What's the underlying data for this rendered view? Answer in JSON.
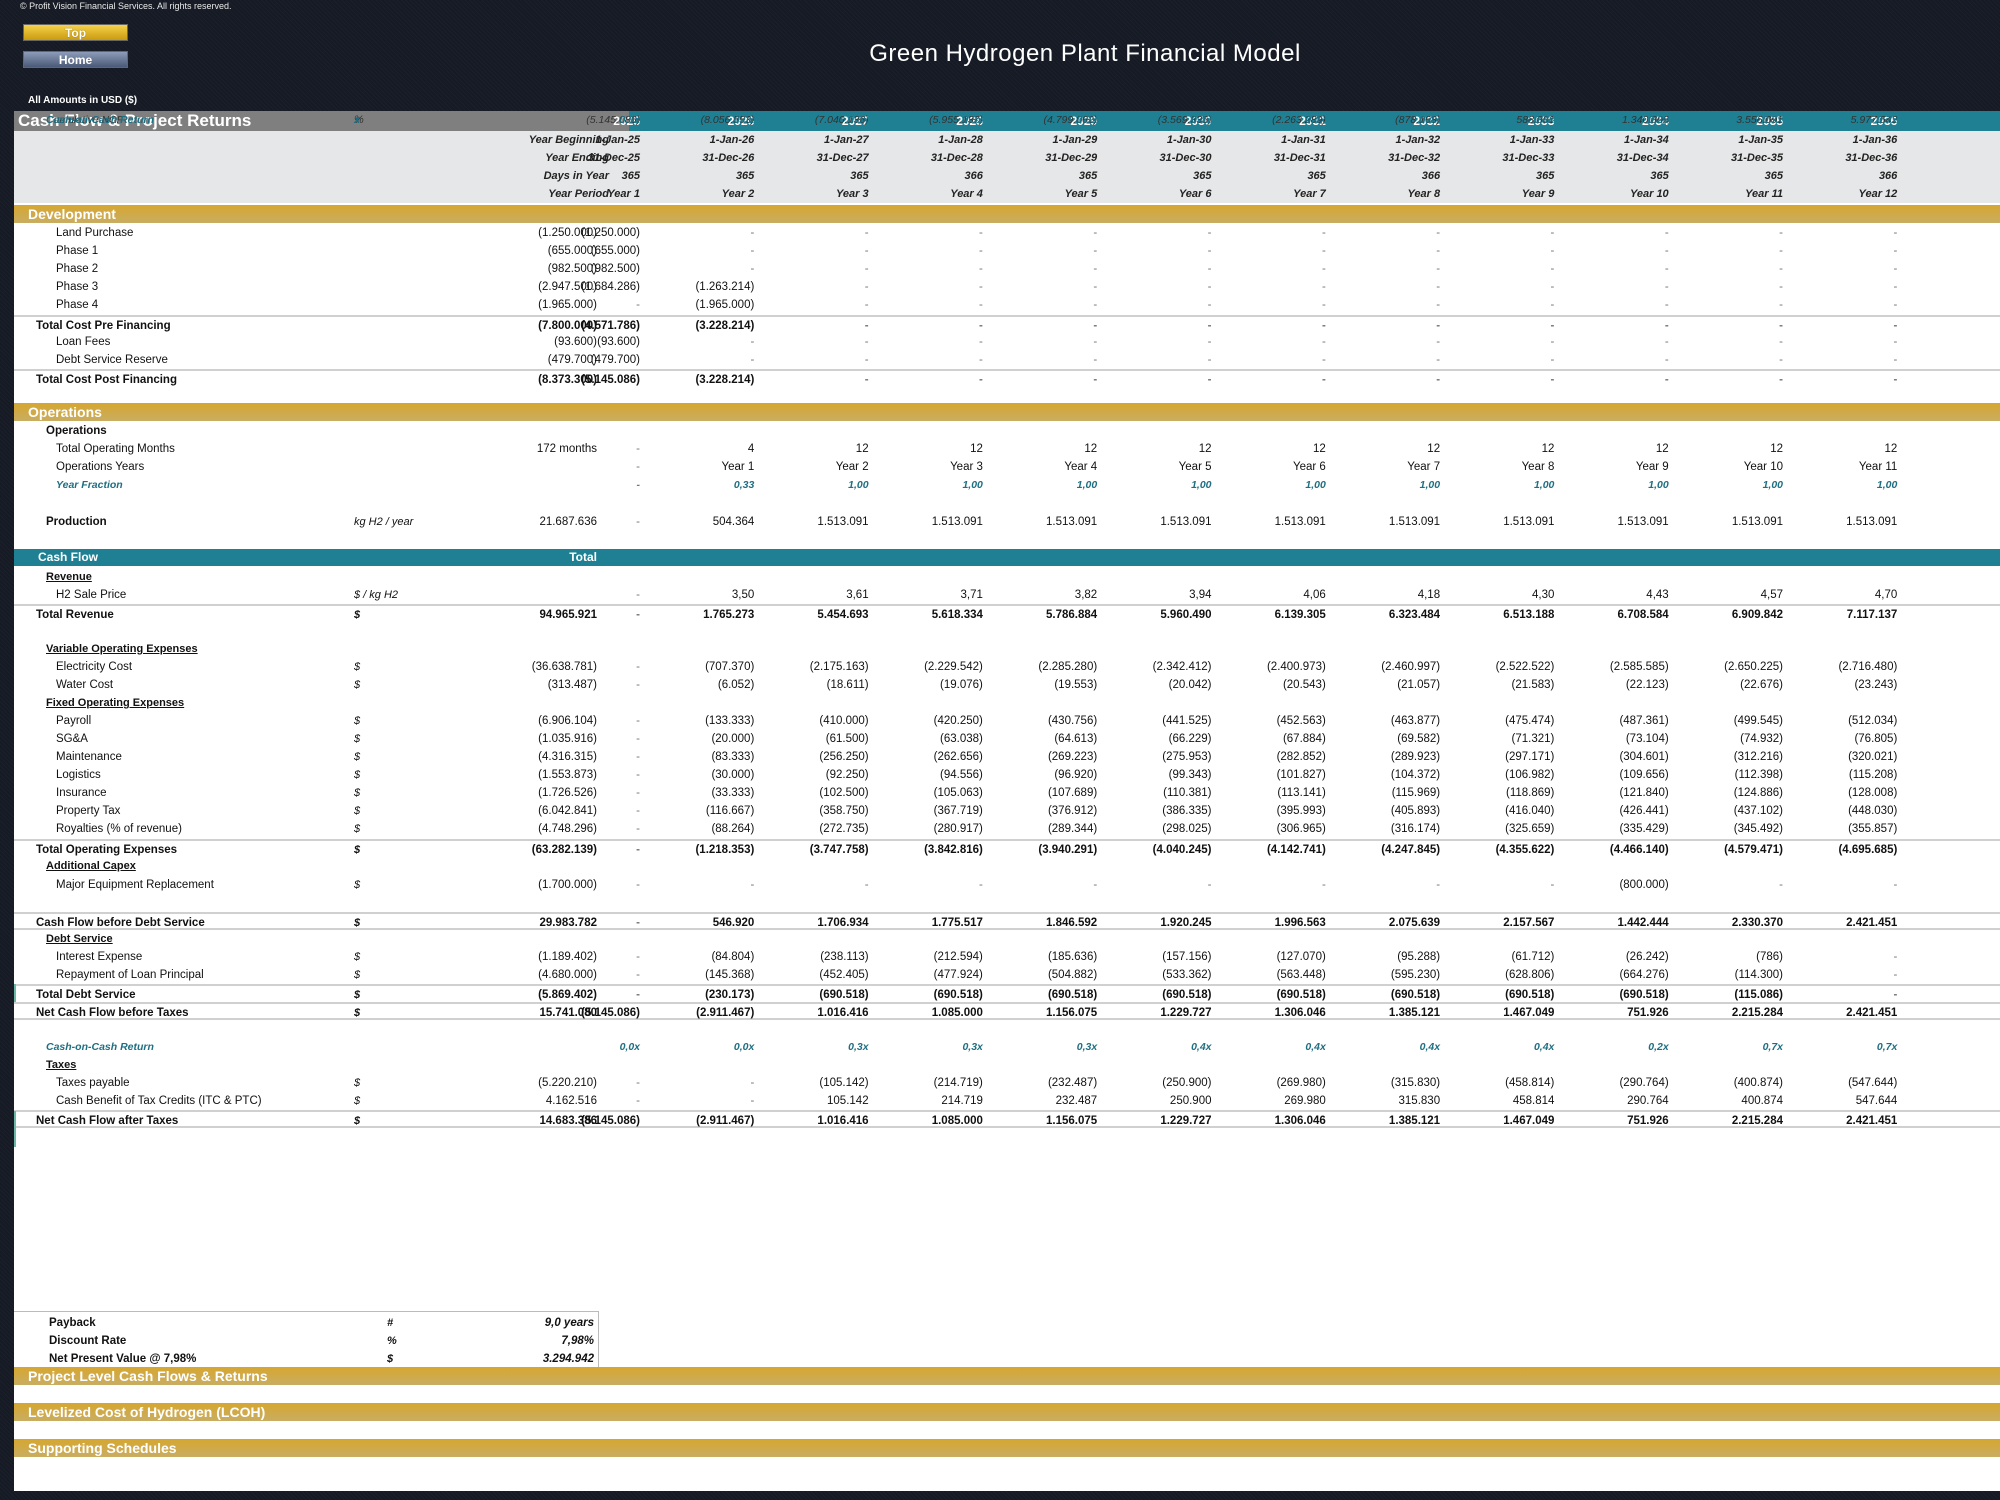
{
  "copyright": "© Profit Vision Financial Services. All rights reserved.",
  "nav": {
    "top_label": "Top",
    "home_label": "Home"
  },
  "title": "Green Hydrogen Plant Financial Model",
  "amounts_note": "All Amounts in  USD ($)",
  "sheet_title": "Cash Flow & Project Returns",
  "years": [
    "2025",
    "2026",
    "2027",
    "2028",
    "2029",
    "2030",
    "2031",
    "2032",
    "2033",
    "2034",
    "2035",
    "2036"
  ],
  "period": [
    {
      "label": "Year Beginning",
      "values": [
        "1-Jan-25",
        "1-Jan-26",
        "1-Jan-27",
        "1-Jan-28",
        "1-Jan-29",
        "1-Jan-30",
        "1-Jan-31",
        "1-Jan-32",
        "1-Jan-33",
        "1-Jan-34",
        "1-Jan-35",
        "1-Jan-36"
      ]
    },
    {
      "label": "Year Ending",
      "values": [
        "31-Dec-25",
        "31-Dec-26",
        "31-Dec-27",
        "31-Dec-28",
        "31-Dec-29",
        "31-Dec-30",
        "31-Dec-31",
        "31-Dec-32",
        "31-Dec-33",
        "31-Dec-34",
        "31-Dec-35",
        "31-Dec-36"
      ]
    },
    {
      "label": "Days in Year",
      "values": [
        "365",
        "365",
        "365",
        "366",
        "365",
        "365",
        "365",
        "366",
        "365",
        "365",
        "365",
        "366"
      ]
    },
    {
      "label": "Year Period",
      "values": [
        "Year 1",
        "Year 2",
        "Year 3",
        "Year 4",
        "Year 5",
        "Year 6",
        "Year 7",
        "Year 8",
        "Year 9",
        "Year 10",
        "Year 11",
        "Year 12"
      ]
    }
  ],
  "sections": {
    "development": "Development",
    "operations": "Operations",
    "cash_flow": "Cash Flow",
    "cash_flow_total": "Total",
    "project_level": "Project Level Cash Flows & Returns",
    "lcoh": "Levelized Cost of Hydrogen (LCOH)",
    "supporting": "Supporting Schedules"
  },
  "development_rows": [
    {
      "label": "Land Purchase",
      "style": "lvl2",
      "total": "(1.250.000)",
      "values": [
        "(1.250.000)",
        "-",
        "-",
        "-",
        "-",
        "-",
        "-",
        "-",
        "-",
        "-",
        "-",
        "-"
      ]
    },
    {
      "label": "Phase 1",
      "style": "lvl2",
      "total": "(655.000)",
      "values": [
        "(655.000)",
        "-",
        "-",
        "-",
        "-",
        "-",
        "-",
        "-",
        "-",
        "-",
        "-",
        "-"
      ]
    },
    {
      "label": "Phase 2",
      "style": "lvl2",
      "total": "(982.500)",
      "values": [
        "(982.500)",
        "-",
        "-",
        "-",
        "-",
        "-",
        "-",
        "-",
        "-",
        "-",
        "-",
        "-"
      ]
    },
    {
      "label": "Phase 3",
      "style": "lvl2",
      "total": "(2.947.500)",
      "values": [
        "(1.684.286)",
        "(1.263.214)",
        "-",
        "-",
        "-",
        "-",
        "-",
        "-",
        "-",
        "-",
        "-",
        "-"
      ]
    },
    {
      "label": "Phase 4",
      "style": "lvl2",
      "total": "(1.965.000)",
      "values": [
        "-",
        "(1.965.000)",
        "-",
        "-",
        "-",
        "-",
        "-",
        "-",
        "-",
        "-",
        "-",
        "-"
      ]
    },
    {
      "label": "Total Cost Pre Financing",
      "style": "bold topline",
      "total": "(7.800.000)",
      "values": [
        "(4.571.786)",
        "(3.228.214)",
        "-",
        "-",
        "-",
        "-",
        "-",
        "-",
        "-",
        "-",
        "-",
        "-"
      ]
    },
    {
      "label": "Loan Fees",
      "style": "lvl2",
      "total": "(93.600)",
      "values": [
        "(93.600)",
        "-",
        "-",
        "-",
        "-",
        "-",
        "-",
        "-",
        "-",
        "-",
        "-",
        "-"
      ]
    },
    {
      "label": "Debt Service Reserve",
      "style": "lvl2",
      "total": "(479.700)",
      "values": [
        "(479.700)",
        "-",
        "-",
        "-",
        "-",
        "-",
        "-",
        "-",
        "-",
        "-",
        "-",
        "-"
      ]
    },
    {
      "label": "Total Cost Post Financing",
      "style": "bold topline",
      "total": "(8.373.300)",
      "values": [
        "(5.145.086)",
        "(3.228.214)",
        "-",
        "-",
        "-",
        "-",
        "-",
        "-",
        "-",
        "-",
        "-",
        "-"
      ]
    }
  ],
  "operations_rows": [
    {
      "label": "Operations",
      "style": "plainhead lvl1",
      "total": "",
      "values": []
    },
    {
      "label": "Total Operating Months",
      "style": "lvl2",
      "total": "172 months",
      "values": [
        "-",
        "4",
        "12",
        "12",
        "12",
        "12",
        "12",
        "12",
        "12",
        "12",
        "12",
        "12"
      ]
    },
    {
      "label": "Operations Years",
      "style": "lvl2",
      "total": "",
      "values": [
        "-",
        "Year 1",
        "Year 2",
        "Year 3",
        "Year 4",
        "Year 5",
        "Year 6",
        "Year 7",
        "Year 8",
        "Year 9",
        "Year 10",
        "Year 11"
      ]
    },
    {
      "label": "Year Fraction",
      "style": "teal lvl2",
      "total": "",
      "values": [
        "-",
        "0,33",
        "1,00",
        "1,00",
        "1,00",
        "1,00",
        "1,00",
        "1,00",
        "1,00",
        "1,00",
        "1,00",
        "1,00"
      ]
    },
    {
      "label": "Production",
      "style": "plainhead lvl1",
      "unit": "kg H2 / year",
      "total": "21.687.636",
      "values": [
        "-",
        "504.364",
        "1.513.091",
        "1.513.091",
        "1.513.091",
        "1.513.091",
        "1.513.091",
        "1.513.091",
        "1.513.091",
        "1.513.091",
        "1.513.091",
        "1.513.091"
      ]
    }
  ],
  "cashflow_rows": [
    {
      "label": "Revenue",
      "style": "heading lvl1",
      "total": "",
      "values": []
    },
    {
      "label": "H2 Sale Price",
      "style": "lvl2",
      "unit": "$ / kg H2",
      "total": "",
      "values": [
        "-",
        "3,50",
        "3,61",
        "3,71",
        "3,82",
        "3,94",
        "4,06",
        "4,18",
        "4,30",
        "4,43",
        "4,57",
        "4,70"
      ]
    },
    {
      "label": "Total Revenue",
      "style": "bold topline lvl0",
      "unit": "$",
      "total": "94.965.921",
      "values": [
        "-",
        "1.765.273",
        "5.454.693",
        "5.618.334",
        "5.786.884",
        "5.960.490",
        "6.139.305",
        "6.323.484",
        "6.513.188",
        "6.708.584",
        "6.909.842",
        "7.117.137"
      ]
    },
    {
      "label": "Variable Operating Expenses",
      "style": "heading lvl1",
      "total": "",
      "values": []
    },
    {
      "label": "Electricity Cost",
      "style": "lvl2",
      "unit": "$",
      "total": "(36.638.781)",
      "values": [
        "-",
        "(707.370)",
        "(2.175.163)",
        "(2.229.542)",
        "(2.285.280)",
        "(2.342.412)",
        "(2.400.973)",
        "(2.460.997)",
        "(2.522.522)",
        "(2.585.585)",
        "(2.650.225)",
        "(2.716.480)"
      ]
    },
    {
      "label": "Water Cost",
      "style": "lvl2",
      "unit": "$",
      "total": "(313.487)",
      "values": [
        "-",
        "(6.052)",
        "(18.611)",
        "(19.076)",
        "(19.553)",
        "(20.042)",
        "(20.543)",
        "(21.057)",
        "(21.583)",
        "(22.123)",
        "(22.676)",
        "(23.243)"
      ]
    },
    {
      "label": "Fixed Operating Expenses",
      "style": "heading lvl1",
      "total": "",
      "values": []
    },
    {
      "label": "Payroll",
      "style": "lvl2",
      "unit": "$",
      "total": "(6.906.104)",
      "values": [
        "-",
        "(133.333)",
        "(410.000)",
        "(420.250)",
        "(430.756)",
        "(441.525)",
        "(452.563)",
        "(463.877)",
        "(475.474)",
        "(487.361)",
        "(499.545)",
        "(512.034)"
      ]
    },
    {
      "label": "SG&A",
      "style": "lvl2",
      "unit": "$",
      "total": "(1.035.916)",
      "values": [
        "-",
        "(20.000)",
        "(61.500)",
        "(63.038)",
        "(64.613)",
        "(66.229)",
        "(67.884)",
        "(69.582)",
        "(71.321)",
        "(73.104)",
        "(74.932)",
        "(76.805)"
      ]
    },
    {
      "label": "Maintenance",
      "style": "lvl2",
      "unit": "$",
      "total": "(4.316.315)",
      "values": [
        "-",
        "(83.333)",
        "(256.250)",
        "(262.656)",
        "(269.223)",
        "(275.953)",
        "(282.852)",
        "(289.923)",
        "(297.171)",
        "(304.601)",
        "(312.216)",
        "(320.021)"
      ]
    },
    {
      "label": "Logistics",
      "style": "lvl2",
      "unit": "$",
      "total": "(1.553.873)",
      "values": [
        "-",
        "(30.000)",
        "(92.250)",
        "(94.556)",
        "(96.920)",
        "(99.343)",
        "(101.827)",
        "(104.372)",
        "(106.982)",
        "(109.656)",
        "(112.398)",
        "(115.208)"
      ]
    },
    {
      "label": "Insurance",
      "style": "lvl2",
      "unit": "$",
      "total": "(1.726.526)",
      "values": [
        "-",
        "(33.333)",
        "(102.500)",
        "(105.063)",
        "(107.689)",
        "(110.381)",
        "(113.141)",
        "(115.969)",
        "(118.869)",
        "(121.840)",
        "(124.886)",
        "(128.008)"
      ]
    },
    {
      "label": "Property Tax",
      "style": "lvl2",
      "unit": "$",
      "total": "(6.042.841)",
      "values": [
        "-",
        "(116.667)",
        "(358.750)",
        "(367.719)",
        "(376.912)",
        "(386.335)",
        "(395.993)",
        "(405.893)",
        "(416.040)",
        "(426.441)",
        "(437.102)",
        "(448.030)"
      ]
    },
    {
      "label": "Royalties (% of revenue)",
      "style": "lvl2",
      "unit": "$",
      "total": "(4.748.296)",
      "values": [
        "-",
        "(88.264)",
        "(272.735)",
        "(280.917)",
        "(289.344)",
        "(298.025)",
        "(306.965)",
        "(316.174)",
        "(325.659)",
        "(335.429)",
        "(345.492)",
        "(355.857)"
      ]
    },
    {
      "label": "Total Operating Expenses",
      "style": "bold topline lvl0",
      "unit": "$",
      "total": "(63.282.139)",
      "values": [
        "-",
        "(1.218.353)",
        "(3.747.758)",
        "(3.842.816)",
        "(3.940.291)",
        "(4.040.245)",
        "(4.142.741)",
        "(4.247.845)",
        "(4.355.622)",
        "(4.466.140)",
        "(4.579.471)",
        "(4.695.685)"
      ]
    },
    {
      "label": "Additional Capex",
      "style": "heading lvl1",
      "total": "",
      "values": []
    },
    {
      "label": "Major Equipment Replacement",
      "style": "lvl2",
      "unit": "$",
      "total": "(1.700.000)",
      "values": [
        "-",
        "-",
        "-",
        "-",
        "-",
        "-",
        "-",
        "-",
        "-",
        "(800.000)",
        "-",
        "-"
      ]
    },
    {
      "label": "Cash Flow before Debt Service",
      "style": "bold boldline lvl0",
      "unit": "$",
      "total": "29.983.782",
      "values": [
        "-",
        "546.920",
        "1.706.934",
        "1.775.517",
        "1.846.592",
        "1.920.245",
        "1.996.563",
        "2.075.639",
        "2.157.567",
        "1.442.444",
        "2.330.370",
        "2.421.451"
      ]
    },
    {
      "label": "Debt Service",
      "style": "heading lvl1",
      "total": "",
      "values": []
    },
    {
      "label": "Interest Expense",
      "style": "lvl2",
      "unit": "$",
      "total": "(1.189.402)",
      "values": [
        "-",
        "(84.804)",
        "(238.113)",
        "(212.594)",
        "(185.636)",
        "(157.156)",
        "(127.070)",
        "(95.288)",
        "(61.712)",
        "(26.242)",
        "(786)",
        "-"
      ]
    },
    {
      "label": "Repayment of Loan Principal",
      "style": "lvl2",
      "unit": "$",
      "total": "(4.680.000)",
      "values": [
        "-",
        "(145.368)",
        "(452.405)",
        "(477.924)",
        "(504.882)",
        "(533.362)",
        "(563.448)",
        "(595.230)",
        "(628.806)",
        "(664.276)",
        "(114.300)",
        "-"
      ]
    },
    {
      "label": "Total Debt Service",
      "style": "bold topline lvl0",
      "unit": "$",
      "total": "(5.869.402)",
      "values": [
        "-",
        "(230.173)",
        "(690.518)",
        "(690.518)",
        "(690.518)",
        "(690.518)",
        "(690.518)",
        "(690.518)",
        "(690.518)",
        "(690.518)",
        "(115.086)",
        "-"
      ]
    },
    {
      "label": "Net Cash Flow before Taxes",
      "style": "bold boldline lvl0",
      "unit": "$",
      "total": "15.741.080",
      "values": [
        "(5.145.086)",
        "(2.911.467)",
        "1.016.416",
        "1.085.000",
        "1.156.075",
        "1.229.727",
        "1.306.046",
        "1.385.121",
        "1.467.049",
        "751.926",
        "2.215.284",
        "2.421.451"
      ]
    },
    {
      "label": "Cash-on-Cash Return",
      "style": "teal lvl1",
      "total": "",
      "values": [
        "0,0x",
        "0,0x",
        "0,3x",
        "0,3x",
        "0,3x",
        "0,4x",
        "0,4x",
        "0,4x",
        "0,4x",
        "0,2x",
        "0,7x",
        "0,7x"
      ]
    },
    {
      "label": "Taxes",
      "style": "heading lvl1",
      "total": "",
      "values": []
    },
    {
      "label": "Taxes payable",
      "style": "lvl2",
      "unit": "$",
      "total": "(5.220.210)",
      "values": [
        "-",
        "-",
        "(105.142)",
        "(214.719)",
        "(232.487)",
        "(250.900)",
        "(269.980)",
        "(315.830)",
        "(458.814)",
        "(290.764)",
        "(400.874)",
        "(547.644)"
      ]
    },
    {
      "label": "Cash Benefit of Tax Credits (ITC & PTC)",
      "style": "lvl2",
      "unit": "$",
      "total": "4.162.516",
      "values": [
        "-",
        "-",
        "105.142",
        "214.719",
        "232.487",
        "250.900",
        "269.980",
        "315.830",
        "458.814",
        "290.764",
        "400.874",
        "547.644"
      ]
    },
    {
      "label": "Net Cash Flow after Taxes",
      "style": "bold boldline lvl0",
      "unit": "$",
      "total": "14.683.386",
      "values": [
        "(5.145.086)",
        "(2.911.467)",
        "1.016.416",
        "1.085.000",
        "1.156.075",
        "1.229.727",
        "1.306.046",
        "1.385.121",
        "1.467.049",
        "751.926",
        "2.215.284",
        "2.421.451"
      ]
    },
    {
      "label": "Cumulative NCF",
      "style": "italic lvl1",
      "unit": "%",
      "total": "",
      "values": [
        "(5.145.086)",
        "(8.056.553)",
        "(7.040.136)",
        "(5.955.137)",
        "(4.799.062)",
        "(3.569.335)",
        "(2.263.289)",
        "(878.168)",
        "588.881",
        "1.340.806",
        "3.556.091",
        "5.977.542"
      ]
    },
    {
      "label": "Cash-on-Cash Return",
      "style": "teal lvl1",
      "unit": "x",
      "total": "",
      "values": [
        "0,0x",
        "0,0x",
        "0,3x",
        "0,3x",
        "0,3x",
        "0,4x",
        "0,4x",
        "0,4x",
        "0,4x",
        "0,2x",
        "0,7x",
        "0,7x"
      ]
    }
  ],
  "summary": [
    {
      "label": "Payback",
      "unit": "#",
      "value": "9,0 years"
    },
    {
      "label": "Discount Rate",
      "unit": "%",
      "value": "7,98%"
    },
    {
      "label": "Net Present Value @ 7,98%",
      "unit": "$",
      "value": "3.294.942"
    }
  ]
}
